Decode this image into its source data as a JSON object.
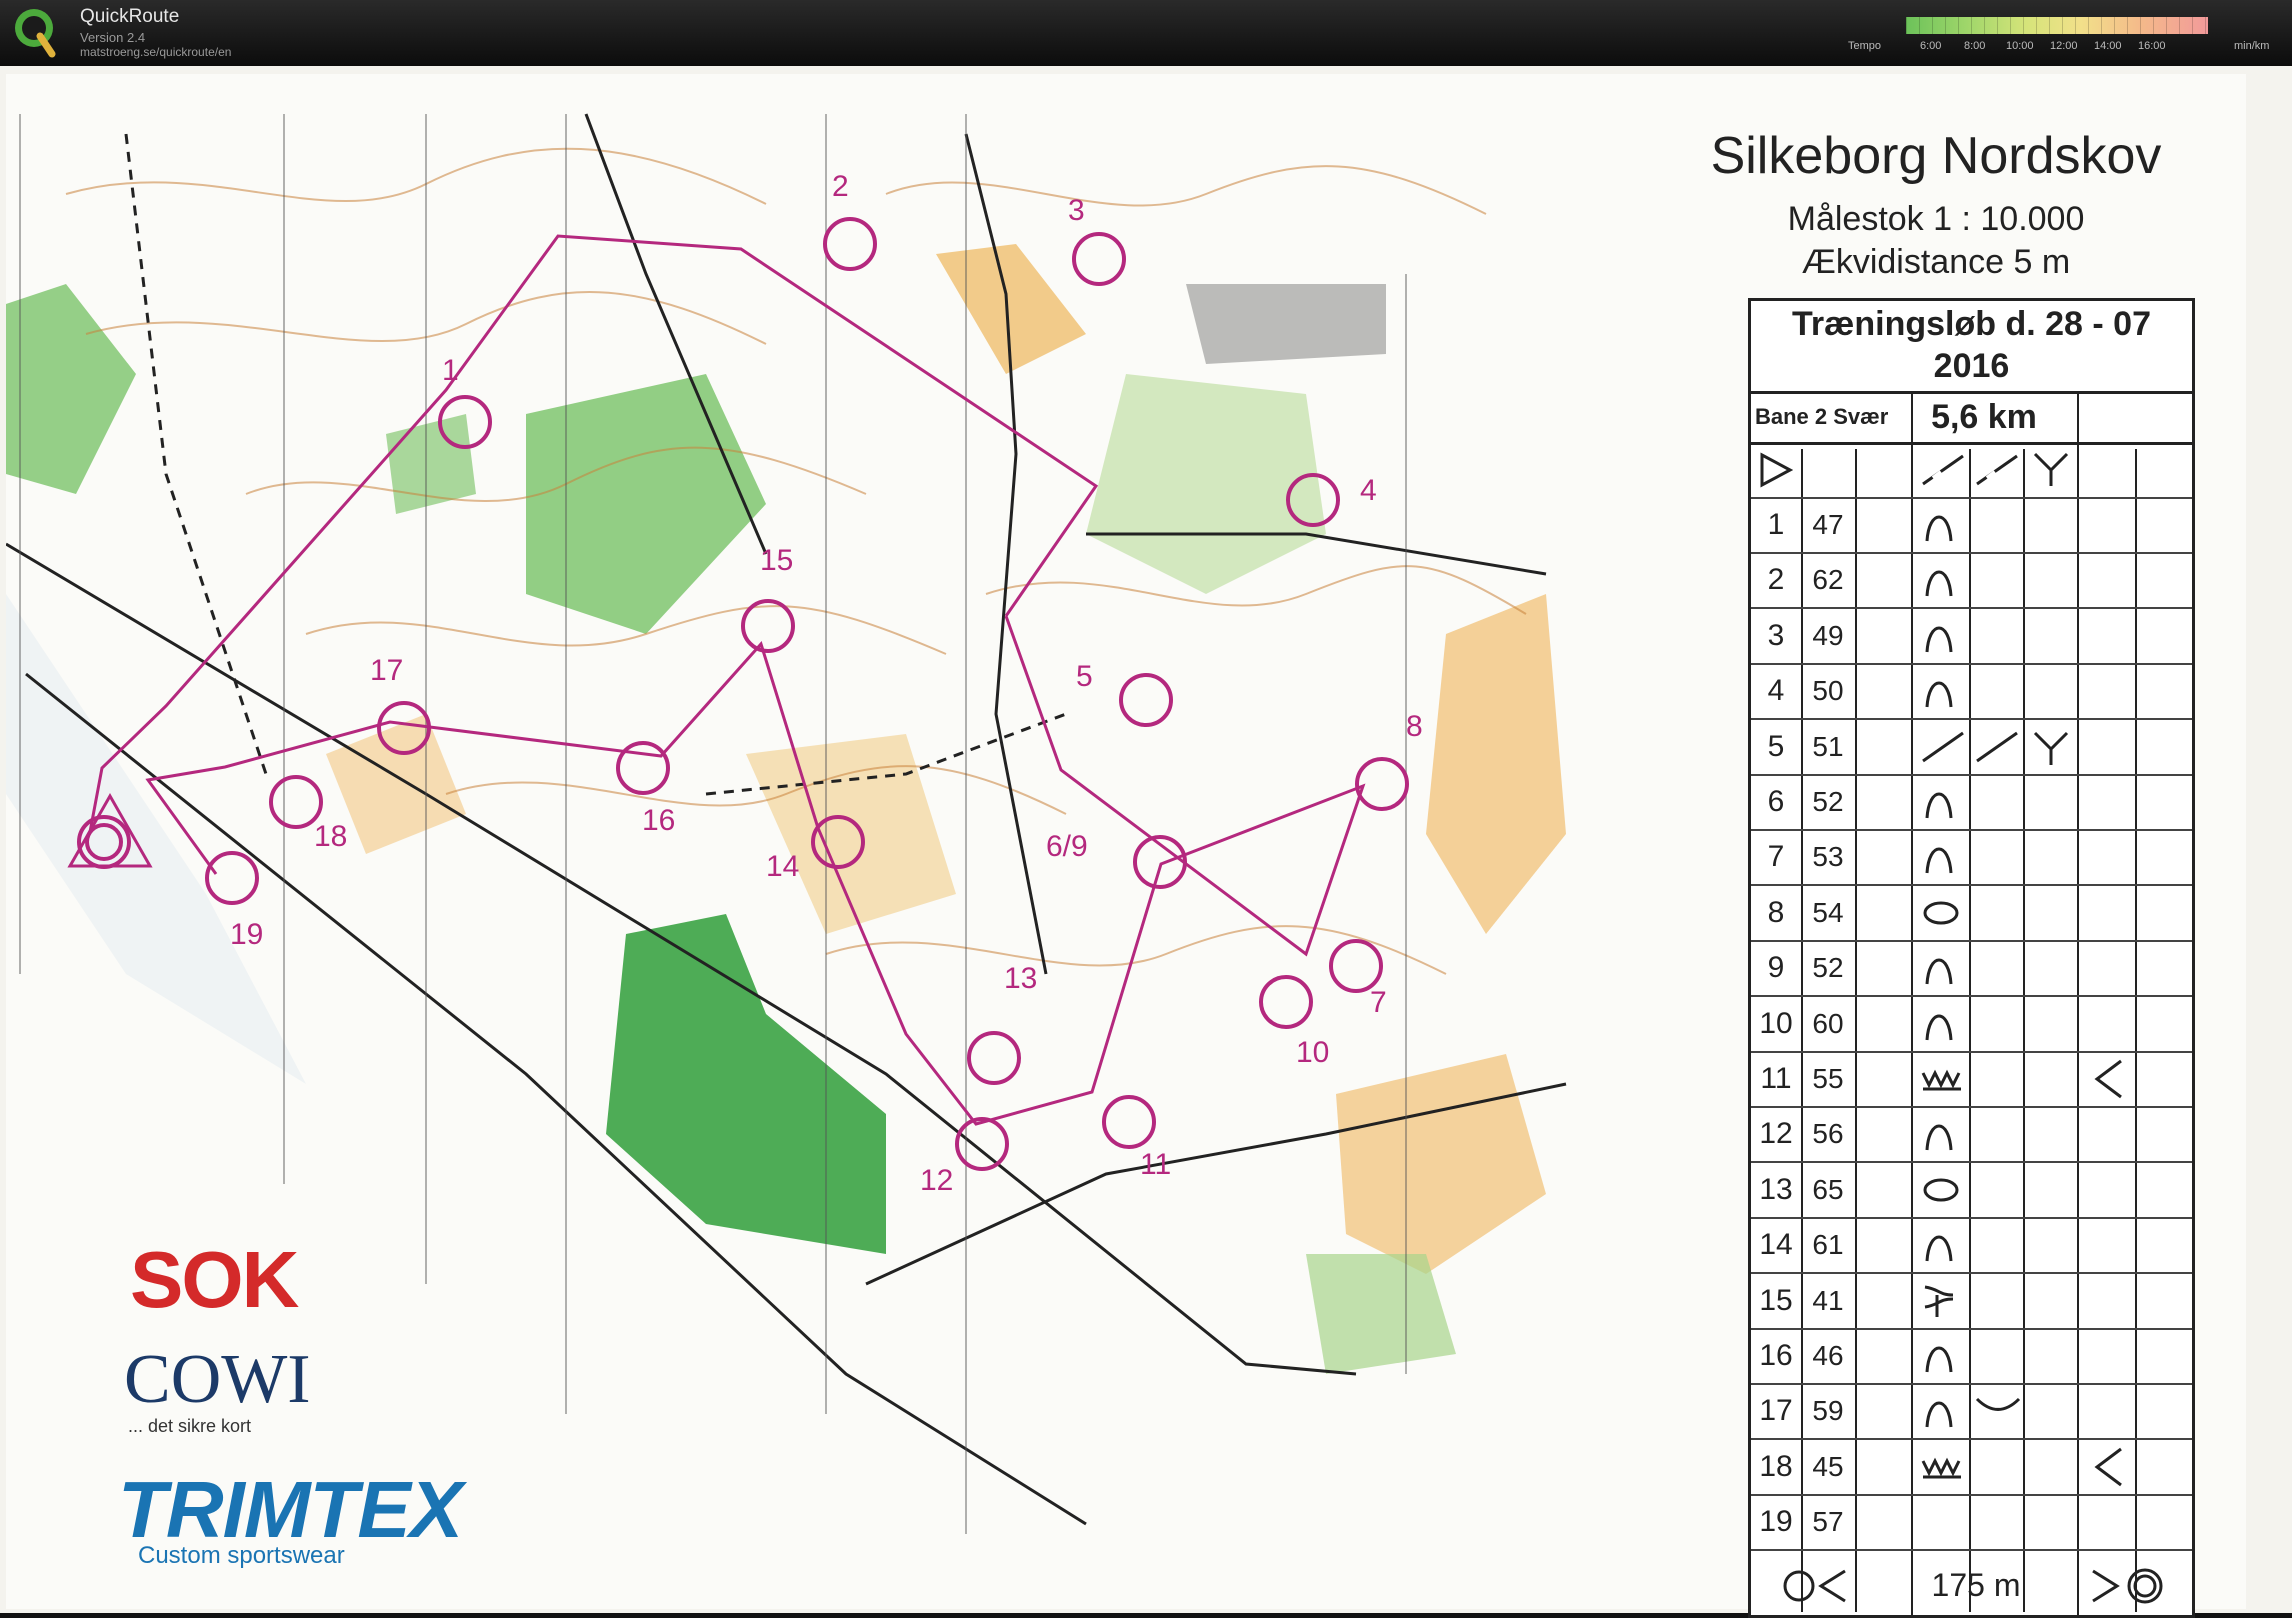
{
  "app": {
    "name": "QuickRoute",
    "version": "Version 2.4",
    "url": "matstroeng.se/quickroute/en",
    "logo_icon": "quickroute-logo-icon"
  },
  "legend": {
    "label": "Tempo",
    "unit": "min/km",
    "ticks": [
      "6:00",
      "8:00",
      "10:00",
      "12:00",
      "14:00",
      "16:00"
    ]
  },
  "map": {
    "title": "Silkeborg Nordskov",
    "scale": "Målestok 1 : 10.000",
    "contour": "Ækvidistance 5 m",
    "controls": [
      "1",
      "2",
      "3",
      "4",
      "5",
      "6/9",
      "7",
      "8",
      "10",
      "11",
      "12",
      "13",
      "14",
      "15",
      "16",
      "17",
      "18",
      "19"
    ]
  },
  "card": {
    "event": "Træningsløb d. 28 - 07",
    "year": "2016",
    "course": "Bane 2 Svær",
    "length": "5,6 km",
    "rows": [
      {
        "n": "1",
        "code": "47"
      },
      {
        "n": "2",
        "code": "62"
      },
      {
        "n": "3",
        "code": "49"
      },
      {
        "n": "4",
        "code": "50"
      },
      {
        "n": "5",
        "code": "51"
      },
      {
        "n": "6",
        "code": "52"
      },
      {
        "n": "7",
        "code": "53"
      },
      {
        "n": "8",
        "code": "54"
      },
      {
        "n": "9",
        "code": "52"
      },
      {
        "n": "10",
        "code": "60"
      },
      {
        "n": "11",
        "code": "55"
      },
      {
        "n": "12",
        "code": "56"
      },
      {
        "n": "13",
        "code": "65"
      },
      {
        "n": "14",
        "code": "61"
      },
      {
        "n": "15",
        "code": "41"
      },
      {
        "n": "16",
        "code": "46"
      },
      {
        "n": "17",
        "code": "59"
      },
      {
        "n": "18",
        "code": "45"
      },
      {
        "n": "19",
        "code": "57"
      }
    ],
    "finish_distance": "175 m"
  },
  "sponsors": {
    "sok": "SOK",
    "cowi": "COWI",
    "cowi_tagline": "... det sikre kort",
    "trimtex": "TRIMTEX",
    "trimtex_tagline": "Custom sportswear"
  },
  "colors": {
    "course": "#b4287e",
    "contour": "#c8813a",
    "forest_green": "#39a040",
    "open_land": "#f3c884"
  }
}
